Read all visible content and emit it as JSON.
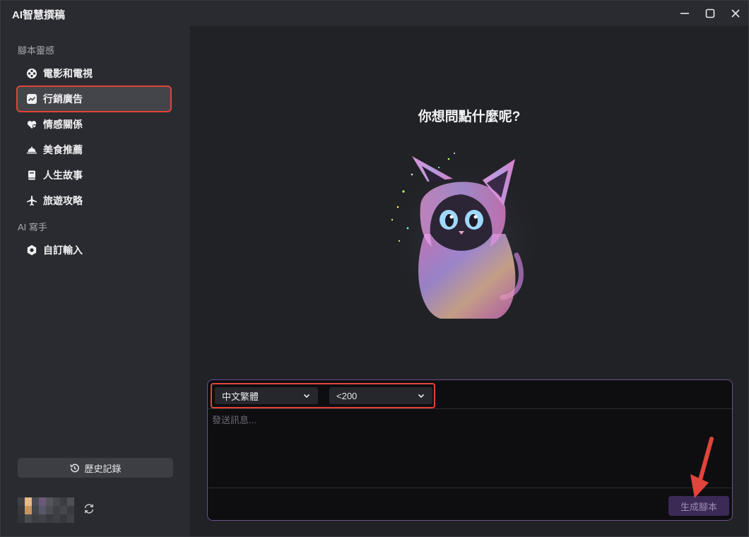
{
  "app": {
    "title": "AI智慧撰稿"
  },
  "sidebar": {
    "section1_label": "腳本靈感",
    "items": [
      {
        "label": "電影和電視",
        "icon": "film-reel-icon"
      },
      {
        "label": "行銷廣告",
        "icon": "trend-chart-icon",
        "active": true
      },
      {
        "label": "情感關係",
        "icon": "hearts-icon"
      },
      {
        "label": "美食推薦",
        "icon": "food-cloche-icon"
      },
      {
        "label": "人生故事",
        "icon": "book-icon"
      },
      {
        "label": "旅遊攻略",
        "icon": "airplane-icon"
      }
    ],
    "section2_label": "AI 寫手",
    "custom_item": {
      "label": "自訂輸入",
      "icon": "gear-icon"
    },
    "history_label": "歷史記錄"
  },
  "main": {
    "headline": "你想問點什麼呢?",
    "language_select": "中文繁體",
    "length_select": "<200",
    "message_placeholder": "發送訊息...",
    "generate_label": "生成腳本"
  },
  "colors": {
    "highlight": "#e0443a",
    "accent_border": "#6b4f8c",
    "generate_bg": "#3a2a55"
  }
}
